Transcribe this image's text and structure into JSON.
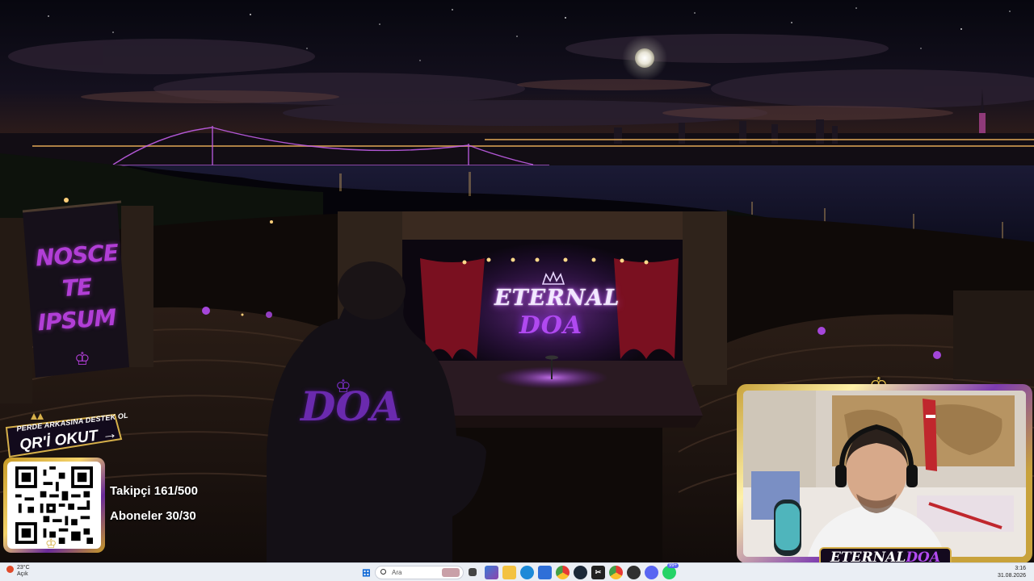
{
  "scene": {
    "banner": {
      "lines": [
        "NOSCE",
        "TE",
        "IPSUM"
      ]
    },
    "stage": {
      "title_line1": "ETERNAL",
      "title_line2": "DOA"
    },
    "hoodie_logo": "DOA"
  },
  "qr_widget": {
    "banner_top": "PERDE ARKASINA DESTEK OL",
    "banner_main": "QR'İ OKUT",
    "followers": "Takipçi 161/500",
    "subscribers": "Aboneler 30/30"
  },
  "webcam": {
    "name_part1": "ETERNAL",
    "name_part2": "DOA"
  },
  "taskbar": {
    "weather_temp": "23°C",
    "weather_desc": "Açık",
    "search_placeholder": "Ara",
    "time": "3:16",
    "date": "31.08.2026",
    "notification_badge": "99+",
    "icons": [
      "windows-start",
      "search",
      "task-view",
      "widgets",
      "file-explorer",
      "edge",
      "store",
      "chrome",
      "steam",
      "capcut",
      "obs",
      "chrome-profile",
      "discord",
      "whatsapp"
    ]
  },
  "colors": {
    "accent_purple": "#b13ed6",
    "gold": "#d6b04a",
    "taskbar": "#eaeef4"
  }
}
